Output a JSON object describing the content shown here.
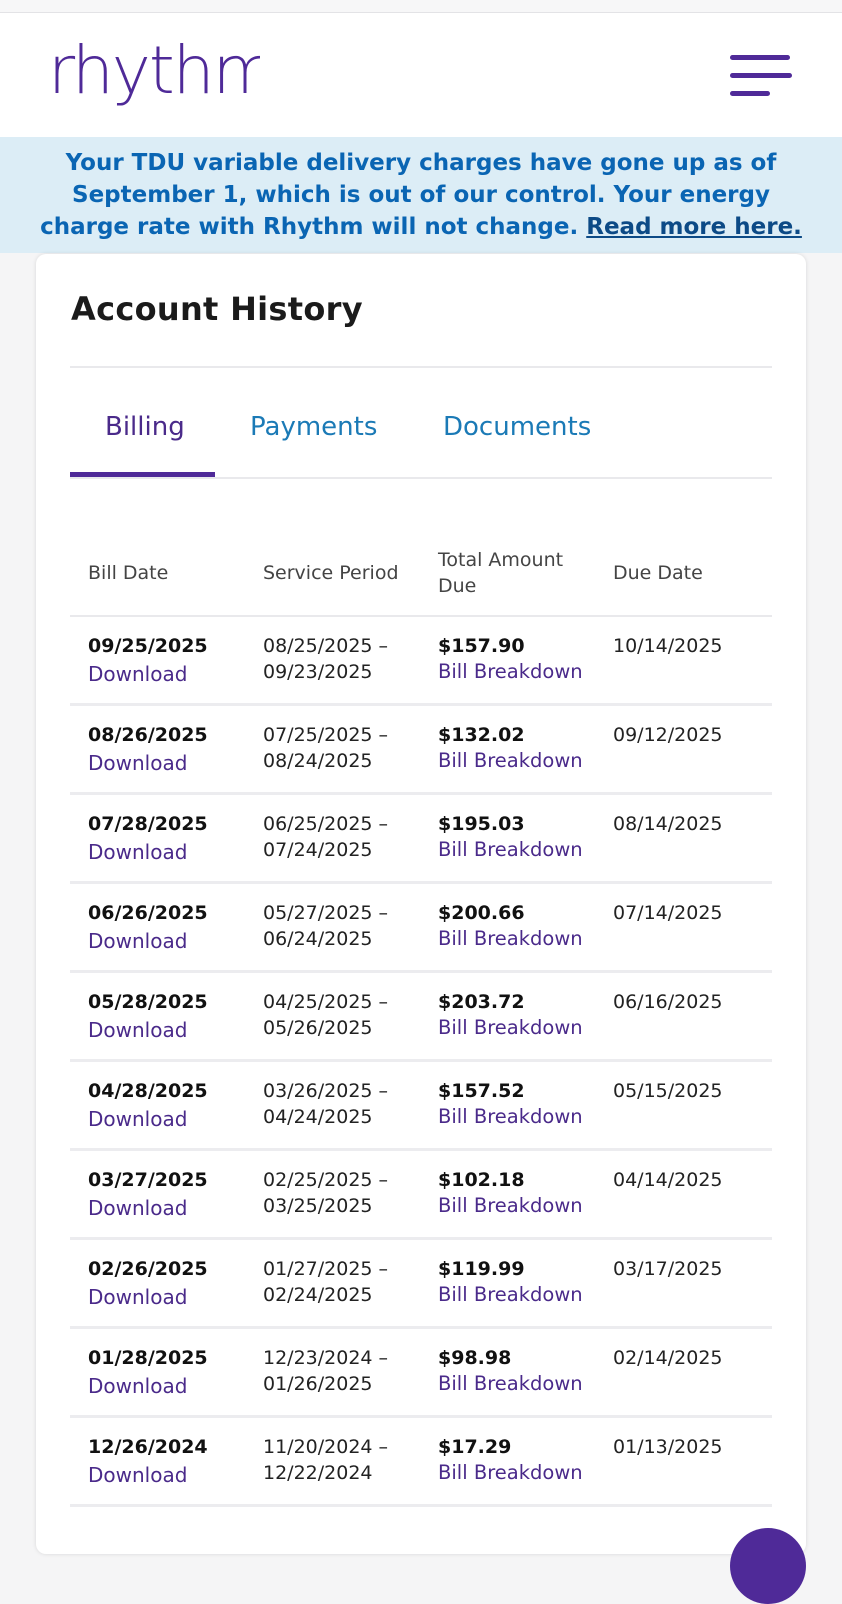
{
  "brand": {
    "logo_text": "rhythm",
    "accent": "#4f2a98"
  },
  "header": {
    "menu_icon": "hamburger-menu-icon"
  },
  "banner": {
    "text": "Your TDU variable delivery charges have gone up as of September 1, which is out of our control. Your energy charge rate with Rhythm will not change.",
    "link": "Read more here."
  },
  "page": {
    "title": "Account History"
  },
  "tabs": [
    {
      "label": "Billing",
      "active": true
    },
    {
      "label": "Payments",
      "active": false
    },
    {
      "label": "Documents",
      "active": false
    }
  ],
  "table": {
    "headers": {
      "bill_date": "Bill Date",
      "service_period": "Service Period",
      "total_amount_l1": "Total Amount",
      "total_amount_l2": "Due",
      "due_date": "Due Date"
    },
    "rows": [
      {
        "bill_date": "09/25/2025",
        "download": "Download",
        "period_start": "08/25/2025 –",
        "period_end": "09/23/2025",
        "amount": "$157.90",
        "breakdown": "Bill Breakdown",
        "due_date": "10/14/2025"
      },
      {
        "bill_date": "08/26/2025",
        "download": "Download",
        "period_start": "07/25/2025 –",
        "period_end": "08/24/2025",
        "amount": "$132.02",
        "breakdown": "Bill Breakdown",
        "due_date": "09/12/2025"
      },
      {
        "bill_date": "07/28/2025",
        "download": "Download",
        "period_start": "06/25/2025 –",
        "period_end": "07/24/2025",
        "amount": "$195.03",
        "breakdown": "Bill Breakdown",
        "due_date": "08/14/2025"
      },
      {
        "bill_date": "06/26/2025",
        "download": "Download",
        "period_start": "05/27/2025 –",
        "period_end": "06/24/2025",
        "amount": "$200.66",
        "breakdown": "Bill Breakdown",
        "due_date": "07/14/2025"
      },
      {
        "bill_date": "05/28/2025",
        "download": "Download",
        "period_start": "04/25/2025 –",
        "period_end": "05/26/2025",
        "amount": "$203.72",
        "breakdown": "Bill Breakdown",
        "due_date": "06/16/2025"
      },
      {
        "bill_date": "04/28/2025",
        "download": "Download",
        "period_start": "03/26/2025 –",
        "period_end": "04/24/2025",
        "amount": "$157.52",
        "breakdown": "Bill Breakdown",
        "due_date": "05/15/2025"
      },
      {
        "bill_date": "03/27/2025",
        "download": "Download",
        "period_start": "02/25/2025 –",
        "period_end": "03/25/2025",
        "amount": "$102.18",
        "breakdown": "Bill Breakdown",
        "due_date": "04/14/2025"
      },
      {
        "bill_date": "02/26/2025",
        "download": "Download",
        "period_start": "01/27/2025 –",
        "period_end": "02/24/2025",
        "amount": "$119.99",
        "breakdown": "Bill Breakdown",
        "due_date": "03/17/2025"
      },
      {
        "bill_date": "01/28/2025",
        "download": "Download",
        "period_start": "12/23/2024 –",
        "period_end": "01/26/2025",
        "amount": "$98.98",
        "breakdown": "Bill Breakdown",
        "due_date": "02/14/2025"
      },
      {
        "bill_date": "12/26/2024",
        "download": "Download",
        "period_start": "11/20/2024 –",
        "period_end": "12/22/2024",
        "amount": "$17.29",
        "breakdown": "Bill Breakdown",
        "due_date": "01/13/2025"
      }
    ]
  }
}
